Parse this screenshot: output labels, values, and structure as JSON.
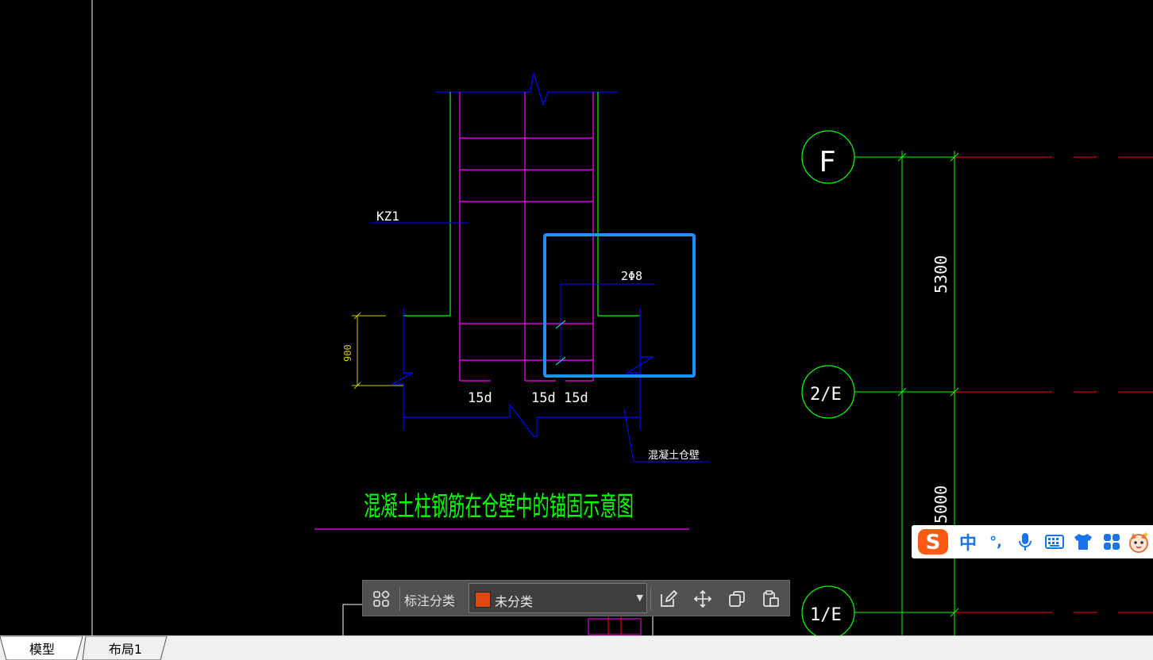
{
  "drawing": {
    "title": "混凝土柱钢筋在仓壁中的锚固示意图",
    "column_label": "KZ1",
    "rebar_label": "2Φ8",
    "dim_900": "900",
    "anchor_labels": [
      "15d",
      "15d",
      "15d"
    ],
    "wall_label": "混凝土仓壁",
    "axis_labels": [
      "F",
      "2/E",
      "1/E"
    ],
    "dims_right": [
      "5300",
      "5000"
    ]
  },
  "toolbar": {
    "label": "标注分类",
    "category_value": "未分类",
    "swatch_color": "#e04a12",
    "buttons": [
      "grid-icon",
      "edit-icon",
      "move-icon",
      "copy-icon",
      "paste-icon"
    ]
  },
  "ime": {
    "logo": "S",
    "mode": "中",
    "punct": "°,",
    "icons": [
      "microphone-icon",
      "keyboard-icon",
      "skin-icon",
      "toolbox-icon",
      "mascot-icon"
    ]
  },
  "tabs": [
    "模型",
    "布局1"
  ],
  "colors": {
    "background": "#000000",
    "green": "#00ff00",
    "magenta": "#ff00ff",
    "blue": "#0000ff",
    "yellow": "#cccc00",
    "red": "#ff0000",
    "highlight": "#1e90ff"
  }
}
